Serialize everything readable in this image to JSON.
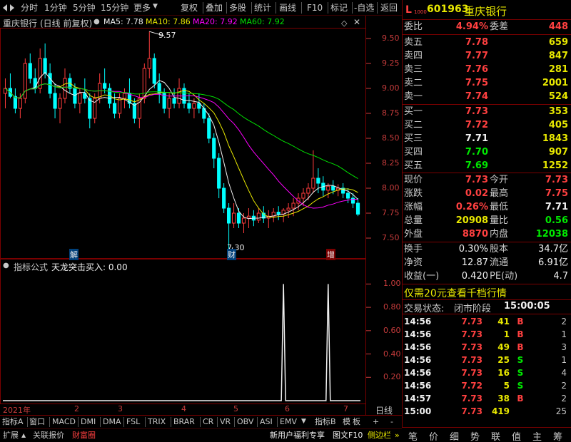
{
  "toolbar": {
    "items": [
      "分时",
      "1分钟",
      "5分钟",
      "15分钟",
      "更多",
      "复权",
      "叠加",
      "多股",
      "统计",
      "画线",
      "F10",
      "标记",
      "-自选",
      "返回"
    ]
  },
  "chart_header": {
    "stock_name": "重庆银行",
    "mode": "(日线 前复权)",
    "ma5": "MA5: 7.78",
    "ma10": "MA10: 7.86",
    "ma20": "MA20: 7.92",
    "ma60": "MA60: 7.92"
  },
  "colors": {
    "up": "#ff3c3c",
    "down": "#00ffff",
    "ma5": "#f0f0f0",
    "ma10": "#e8e800",
    "ma20": "#ff00ff",
    "ma60": "#00e000",
    "axis_red": "#c83c3c",
    "bg": "#000000"
  },
  "chart_data": [
    {
      "type": "candlestick",
      "title": "重庆银行",
      "ylim": [
        7.3,
        9.6
      ],
      "y_ticks": [
        "9.50",
        "9.25",
        "9.00",
        "8.75",
        "8.50",
        "8.25",
        "8.00",
        "7.75",
        "7.50"
      ],
      "annotations": [
        {
          "text": "9.57",
          "label": "high"
        },
        {
          "text": "7.30",
          "label": "low"
        },
        {
          "text": "解",
          "label": "event"
        },
        {
          "text": "财",
          "label": "event"
        },
        {
          "text": "增",
          "label": "event"
        }
      ],
      "series_ohlc": [
        [
          8.95,
          9.1,
          8.8,
          9.0
        ],
        [
          9.0,
          9.15,
          8.9,
          8.92
        ],
        [
          8.92,
          9.0,
          8.75,
          8.8
        ],
        [
          8.8,
          8.95,
          8.7,
          8.9
        ],
        [
          8.9,
          9.3,
          8.85,
          9.25
        ],
        [
          9.25,
          9.35,
          9.05,
          9.1
        ],
        [
          9.1,
          9.2,
          8.95,
          9.0
        ],
        [
          9.0,
          9.4,
          8.95,
          9.3
        ],
        [
          9.3,
          9.45,
          9.1,
          9.15
        ],
        [
          9.15,
          9.25,
          8.9,
          8.95
        ],
        [
          8.95,
          9.05,
          8.7,
          8.8
        ],
        [
          8.8,
          8.95,
          8.65,
          8.9
        ],
        [
          8.9,
          9.2,
          8.85,
          9.1
        ],
        [
          9.1,
          9.15,
          8.95,
          9.0
        ],
        [
          9.0,
          9.05,
          8.8,
          8.85
        ],
        [
          8.85,
          9.0,
          8.75,
          8.95
        ],
        [
          8.95,
          9.1,
          8.85,
          8.9
        ],
        [
          8.9,
          8.95,
          8.6,
          8.7
        ],
        [
          8.7,
          8.95,
          8.65,
          8.9
        ],
        [
          8.9,
          9.15,
          8.85,
          9.05
        ],
        [
          9.05,
          9.2,
          8.95,
          9.0
        ],
        [
          9.0,
          9.05,
          8.8,
          8.85
        ],
        [
          8.85,
          8.95,
          8.7,
          8.75
        ],
        [
          8.75,
          8.95,
          8.7,
          8.9
        ],
        [
          8.9,
          9.0,
          8.8,
          8.95
        ],
        [
          8.95,
          9.1,
          8.8,
          8.85
        ],
        [
          8.85,
          8.9,
          8.65,
          8.7
        ],
        [
          8.7,
          8.95,
          8.6,
          8.9
        ],
        [
          8.9,
          9.25,
          8.85,
          9.2
        ],
        [
          9.2,
          9.57,
          9.1,
          9.3
        ],
        [
          9.3,
          9.35,
          9.0,
          9.05
        ],
        [
          9.05,
          9.15,
          8.85,
          8.95
        ],
        [
          8.95,
          9.0,
          8.75,
          8.8
        ],
        [
          8.8,
          8.95,
          8.7,
          8.9
        ],
        [
          8.9,
          9.0,
          8.8,
          8.85
        ],
        [
          8.85,
          9.1,
          8.8,
          9.0
        ],
        [
          9.0,
          9.05,
          8.8,
          8.85
        ],
        [
          8.85,
          8.95,
          8.75,
          8.8
        ],
        [
          8.8,
          8.9,
          8.7,
          8.85
        ],
        [
          8.85,
          8.95,
          8.75,
          8.8
        ],
        [
          8.8,
          8.85,
          8.65,
          8.7
        ],
        [
          8.7,
          8.75,
          8.45,
          8.5
        ],
        [
          8.5,
          8.55,
          8.2,
          8.3
        ],
        [
          8.3,
          8.35,
          7.9,
          8.0
        ],
        [
          8.0,
          8.05,
          7.75,
          7.8
        ],
        [
          7.8,
          7.85,
          7.3,
          7.65
        ],
        [
          7.65,
          7.85,
          7.6,
          7.75
        ],
        [
          7.75,
          7.8,
          7.6,
          7.65
        ],
        [
          7.65,
          7.75,
          7.55,
          7.7
        ],
        [
          7.7,
          7.8,
          7.6,
          7.72
        ],
        [
          7.72,
          7.78,
          7.62,
          7.68
        ],
        [
          7.68,
          7.8,
          7.65,
          7.75
        ],
        [
          7.75,
          7.82,
          7.65,
          7.7
        ],
        [
          7.7,
          7.78,
          7.6,
          7.72
        ],
        [
          7.72,
          7.8,
          7.66,
          7.76
        ],
        [
          7.76,
          7.82,
          7.68,
          7.74
        ],
        [
          7.74,
          7.8,
          7.66,
          7.78
        ],
        [
          7.78,
          7.85,
          7.7,
          7.8
        ],
        [
          7.8,
          7.9,
          7.72,
          7.85
        ],
        [
          7.85,
          7.95,
          7.78,
          7.9
        ],
        [
          7.9,
          8.0,
          7.82,
          7.95
        ],
        [
          7.95,
          8.05,
          7.88,
          8.0
        ],
        [
          8.0,
          8.38,
          7.95,
          8.1
        ],
        [
          8.1,
          8.2,
          7.95,
          8.05
        ],
        [
          8.05,
          8.12,
          7.92,
          7.98
        ],
        [
          7.98,
          8.05,
          7.9,
          8.02
        ],
        [
          8.02,
          8.08,
          7.94,
          7.98
        ],
        [
          7.98,
          8.04,
          7.92,
          8.0
        ],
        [
          8.0,
          8.05,
          7.9,
          7.95
        ],
        [
          7.95,
          8.0,
          7.85,
          7.9
        ],
        [
          7.9,
          7.95,
          7.8,
          7.85
        ],
        [
          7.85,
          7.9,
          7.72,
          7.74
        ]
      ]
    },
    {
      "type": "line",
      "title": "天龙突击买入: 0.00",
      "ylim": [
        0,
        1.1
      ],
      "y_ticks": [
        "1.00",
        "0.80",
        "0.60",
        "0.40",
        "0.20"
      ],
      "spikes": [
        {
          "bar_index": 56,
          "value": 1.0
        },
        {
          "bar_index": 65,
          "value": 1.0
        }
      ]
    }
  ],
  "sub_header": {
    "formula_label": "指标公式",
    "indicator": "天龙突击买入: 0.00"
  },
  "date_axis": {
    "labels": [
      "2021年",
      "2",
      "3",
      "4",
      "5",
      "6",
      "7"
    ],
    "right_label": "日线"
  },
  "tabs_row1": [
    "指标A",
    "窗口",
    "MACD",
    "DMI",
    "DMA",
    "FSL",
    "TRIX",
    "BRAR",
    "CR",
    "VR",
    "OBV",
    "ASI",
    "EMV",
    "指标B",
    "模",
    "板",
    "+",
    "-"
  ],
  "tabs_row2": {
    "left": [
      "扩展",
      "关联报价",
      "财富圈"
    ],
    "right": [
      "新用户福利专享",
      "图文F10",
      "侧边栏"
    ]
  },
  "quote": {
    "flag": "L",
    "code": "601963",
    "name": "重庆银行",
    "weibi_label": "委比",
    "weibi": "4.94%",
    "weicha_label": "委差",
    "weicha": "448",
    "asks": [
      {
        "label": "卖五",
        "price": "7.78",
        "vol": "659"
      },
      {
        "label": "卖四",
        "price": "7.77",
        "vol": "847"
      },
      {
        "label": "卖三",
        "price": "7.76",
        "vol": "281"
      },
      {
        "label": "卖二",
        "price": "7.75",
        "vol": "2001"
      },
      {
        "label": "卖一",
        "price": "7.74",
        "vol": "524"
      }
    ],
    "bids": [
      {
        "label": "买一",
        "price": "7.73",
        "vol": "353"
      },
      {
        "label": "买二",
        "price": "7.72",
        "vol": "405"
      },
      {
        "label": "买三",
        "price": "7.71",
        "vol": "1843"
      },
      {
        "label": "买四",
        "price": "7.70",
        "vol": "907"
      },
      {
        "label": "买五",
        "price": "7.69",
        "vol": "1252"
      }
    ],
    "stats": [
      {
        "l1": "现价",
        "v1": "7.73",
        "l2": "今开",
        "v2": "7.73"
      },
      {
        "l1": "涨跌",
        "v1": "0.02",
        "l2": "最高",
        "v2": "7.75"
      },
      {
        "l1": "涨幅",
        "v1": "0.26%",
        "l2": "最低",
        "v2": "7.71"
      },
      {
        "l1": "总量",
        "v1": "20908",
        "l2": "量比",
        "v2": "0.56"
      },
      {
        "l1": "外盘",
        "v1": "8870",
        "l2": "内盘",
        "v2": "12038"
      }
    ],
    "fin": [
      {
        "l1": "换手",
        "v1": "0.30%",
        "l2": "股本",
        "v2": "34.7亿"
      },
      {
        "l1": "净资",
        "v1": "12.87",
        "l2": "流通",
        "v2": "6.91亿"
      },
      {
        "l1": "收益(一)",
        "v1": "0.420",
        "l2": "PE(动)",
        "v2": "4.7"
      }
    ],
    "promo": "仅需20元查看千档行情",
    "trade_status_label": "交易状态:",
    "trade_status": "闭市阶段",
    "trade_time": "15:00:05"
  },
  "ticks": [
    {
      "time": "14:56",
      "price": "7.73",
      "vol": "41",
      "bs": "B",
      "n": "2"
    },
    {
      "time": "14:56",
      "price": "7.73",
      "vol": "1",
      "bs": "B",
      "n": "1"
    },
    {
      "time": "14:56",
      "price": "7.73",
      "vol": "49",
      "bs": "B",
      "n": "3"
    },
    {
      "time": "14:56",
      "price": "7.73",
      "vol": "25",
      "bs": "S",
      "n": "1"
    },
    {
      "time": "14:56",
      "price": "7.73",
      "vol": "16",
      "bs": "S",
      "n": "4"
    },
    {
      "time": "14:56",
      "price": "7.72",
      "vol": "5",
      "bs": "S",
      "n": "2"
    },
    {
      "time": "14:57",
      "price": "7.73",
      "vol": "38",
      "bs": "B",
      "n": "2"
    },
    {
      "time": "15:00",
      "price": "7.73",
      "vol": "419",
      "bs": "",
      "n": "25"
    }
  ],
  "bottom_tabs": [
    "笔",
    "价",
    "细",
    "势",
    "联",
    "值",
    "主",
    "筹"
  ]
}
